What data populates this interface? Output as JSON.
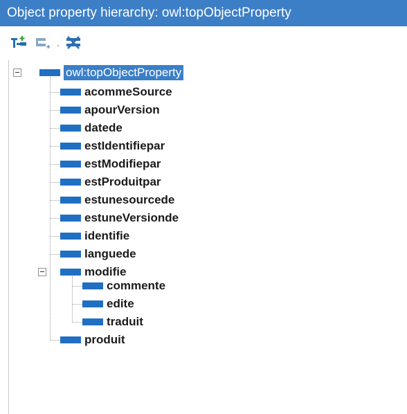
{
  "title": "Object property hierarchy: owl:topObjectProperty",
  "toolbar": {
    "buttons": [
      {
        "name": "add-subproperty-button",
        "icon": "add-subproperty-icon"
      },
      {
        "name": "add-sibling-button",
        "icon": "add-sibling-icon"
      },
      {
        "name": "delete-property-button",
        "icon": "delete-icon"
      }
    ]
  },
  "colors": {
    "titlebar": "#3c7fc6",
    "property_icon": "#1f6fc3",
    "selection": "#3a7fc8"
  },
  "tree": {
    "root": {
      "label": "owl:topObjectProperty",
      "selected": true,
      "expanded": true
    },
    "children": [
      {
        "label": "acommeSource"
      },
      {
        "label": "apourVersion"
      },
      {
        "label": "datede"
      },
      {
        "label": "estIdentifiepar"
      },
      {
        "label": "estModifiepar"
      },
      {
        "label": "estProduitpar"
      },
      {
        "label": "estunesourcede"
      },
      {
        "label": "estuneVersionde"
      },
      {
        "label": "identifie"
      },
      {
        "label": "languede"
      },
      {
        "label": "modifie",
        "expanded": true,
        "children": [
          {
            "label": "commente"
          },
          {
            "label": "edite"
          },
          {
            "label": "traduit"
          }
        ]
      },
      {
        "label": "produit"
      }
    ]
  }
}
